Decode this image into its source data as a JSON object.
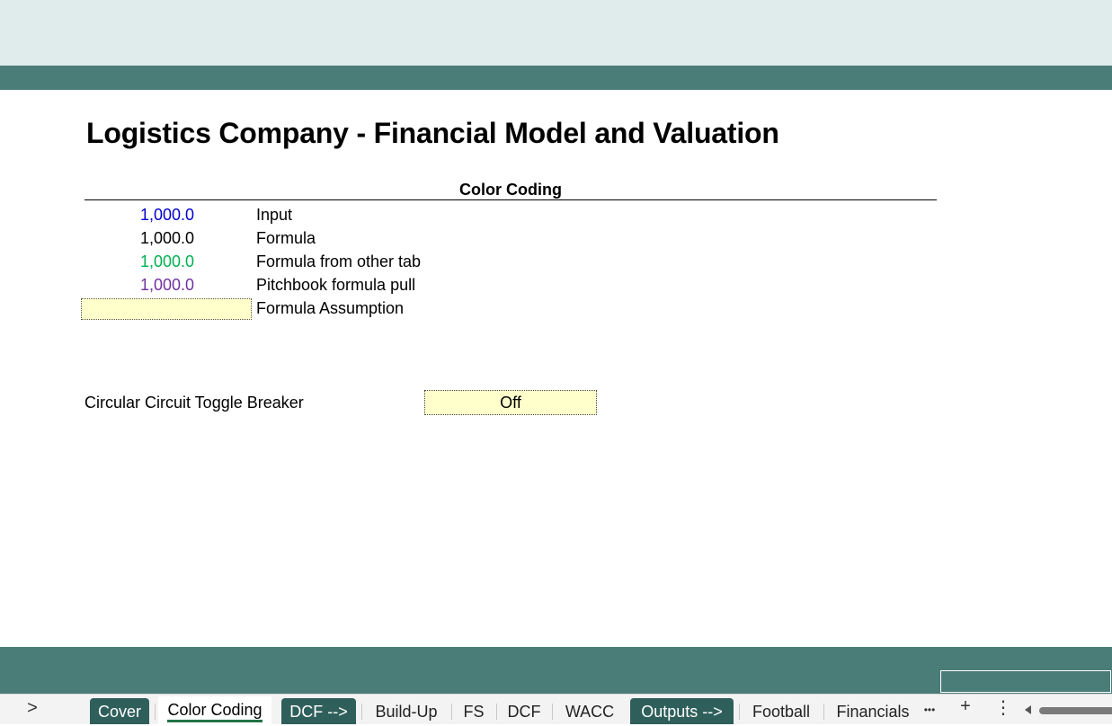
{
  "title": "Logistics Company - Financial Model and Valuation",
  "legend": {
    "header": "Color Coding",
    "rows": [
      {
        "value": "1,000.0",
        "label": "Input",
        "color": "#0000cc"
      },
      {
        "value": "1,000.0",
        "label": "Formula",
        "color": "#000000"
      },
      {
        "value": "1,000.0",
        "label": "Formula from other tab",
        "color": "#00b050"
      },
      {
        "value": "1,000.0",
        "label": "Pitchbook formula pull",
        "color": "#7030a0"
      },
      {
        "value": "",
        "label": "Formula Assumption",
        "color": "#ffffcc"
      }
    ]
  },
  "toggle": {
    "label": "Circular Circuit Toggle Breaker",
    "value": "Off"
  },
  "tabs": [
    {
      "label": "Cover",
      "style": "dark"
    },
    {
      "label": "Color Coding",
      "style": "active"
    },
    {
      "label": "DCF -->",
      "style": "dark"
    },
    {
      "label": "Build-Up",
      "style": "plain"
    },
    {
      "label": "FS",
      "style": "plain"
    },
    {
      "label": "DCF",
      "style": "plain"
    },
    {
      "label": "WACC",
      "style": "plain"
    },
    {
      "label": "Outputs -->",
      "style": "dark"
    },
    {
      "label": "Football",
      "style": "plain"
    },
    {
      "label": "Financials",
      "style": "plain"
    }
  ],
  "tabbar_controls": {
    "nav_next": ">",
    "more": "•••",
    "add": "+",
    "menu": "⋮"
  },
  "colors": {
    "header_band": "#4a7c78",
    "dark_tab": "#2f5f5b",
    "assumption_fill": "#ffffcc"
  }
}
